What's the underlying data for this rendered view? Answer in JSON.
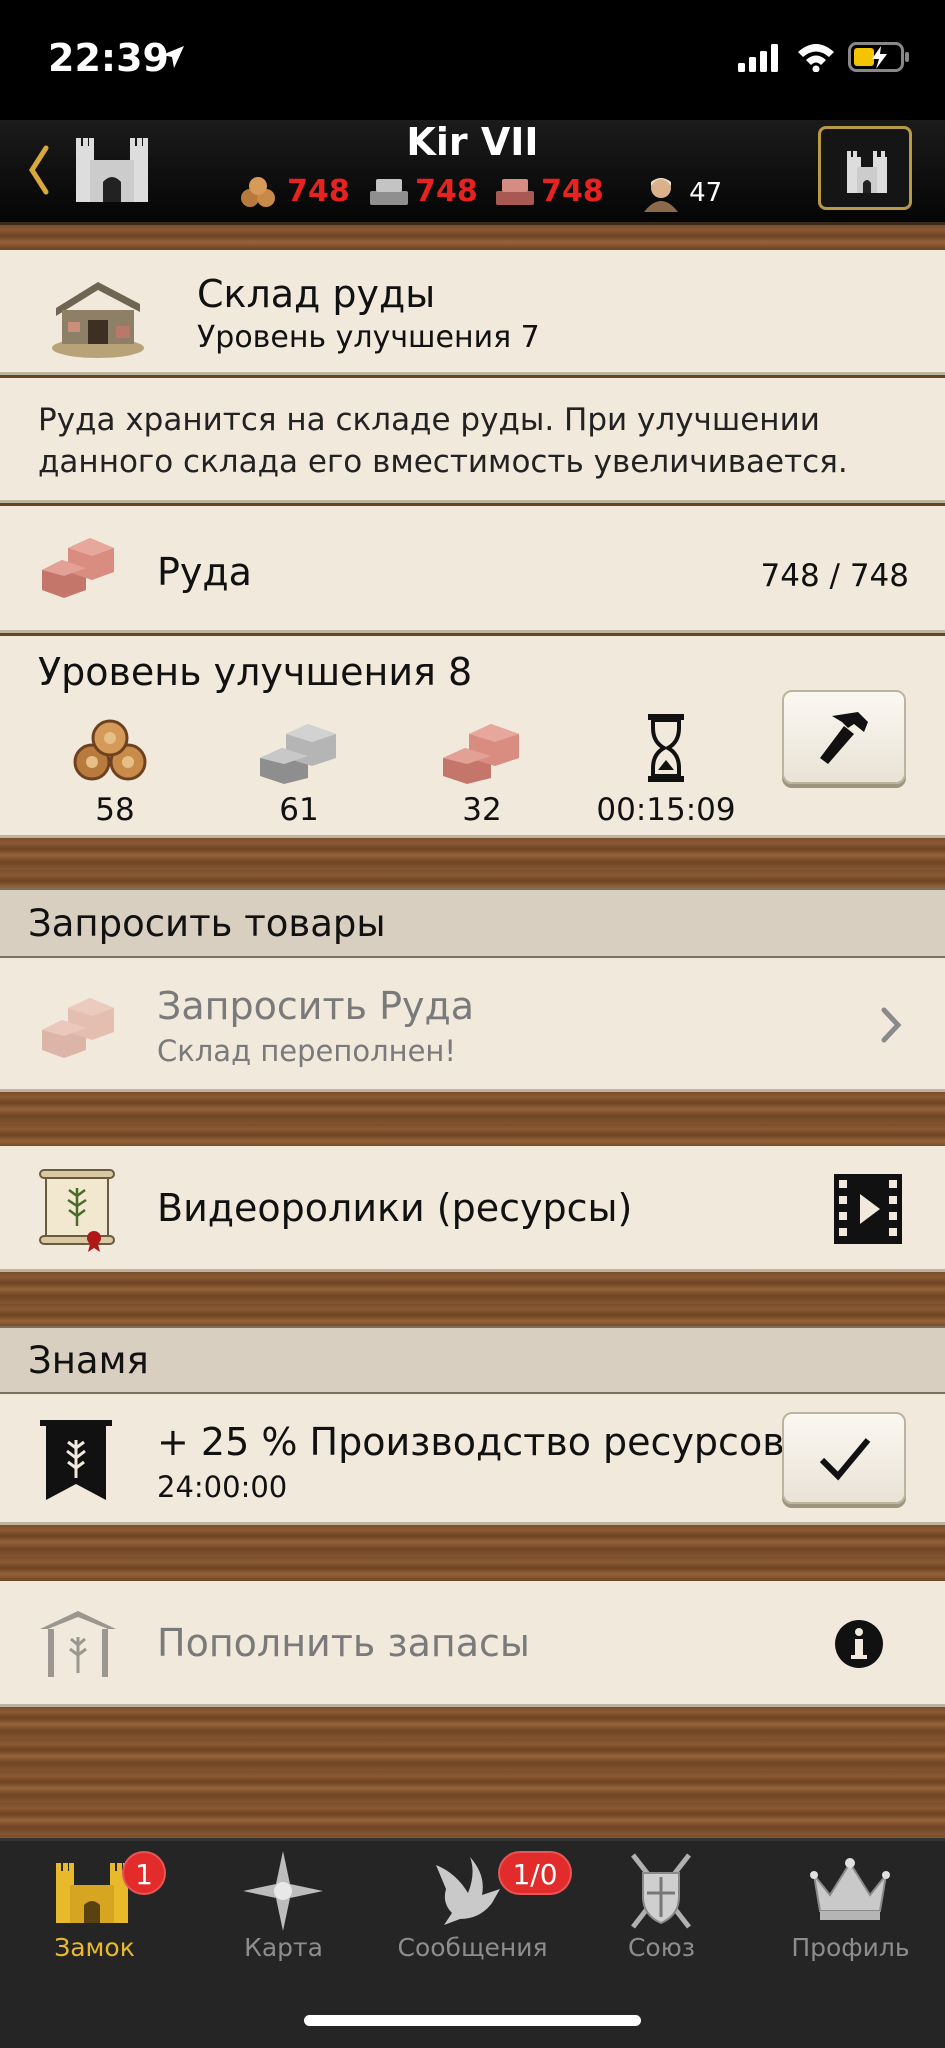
{
  "status": {
    "time": "22:39"
  },
  "header": {
    "player_name": "Kir VII",
    "resources": {
      "wood": "748",
      "stone": "748",
      "ore": "748",
      "population": "47"
    }
  },
  "building": {
    "name": "Склад руды",
    "level_text": "Уровень улучшения 7",
    "description_line1": "Руда хранится на складе руды. При улучшении",
    "description_line2": "данного склада его вместимость увеличивается."
  },
  "capacity": {
    "resource_label": "Руда",
    "value": "748 / 748"
  },
  "upgrade": {
    "title": "Уровень улучшения 8",
    "wood_cost": "58",
    "stone_cost": "61",
    "ore_cost": "32",
    "time": "00:15:09"
  },
  "request_section": {
    "title": "Запросить товары",
    "item_title": "Запросить Руда",
    "item_subtitle": "Склад переполнен!"
  },
  "videos": {
    "label": "Видеоролики (ресурсы)"
  },
  "banner_section": {
    "title": "Знамя",
    "effect": "+ 25 % Производство ресурсов",
    "duration": "24:00:00"
  },
  "replenish": {
    "label": "Пополнить запасы"
  },
  "tabs": [
    {
      "label": "Замок",
      "badge": "1"
    },
    {
      "label": "Карта"
    },
    {
      "label": "Сообщения",
      "badge": "1/0"
    },
    {
      "label": "Союз"
    },
    {
      "label": "Профиль"
    }
  ],
  "colors": {
    "active_tab": "#e8b92b",
    "resource_red": "#e8231f",
    "badge_red": "#e22b2b"
  }
}
